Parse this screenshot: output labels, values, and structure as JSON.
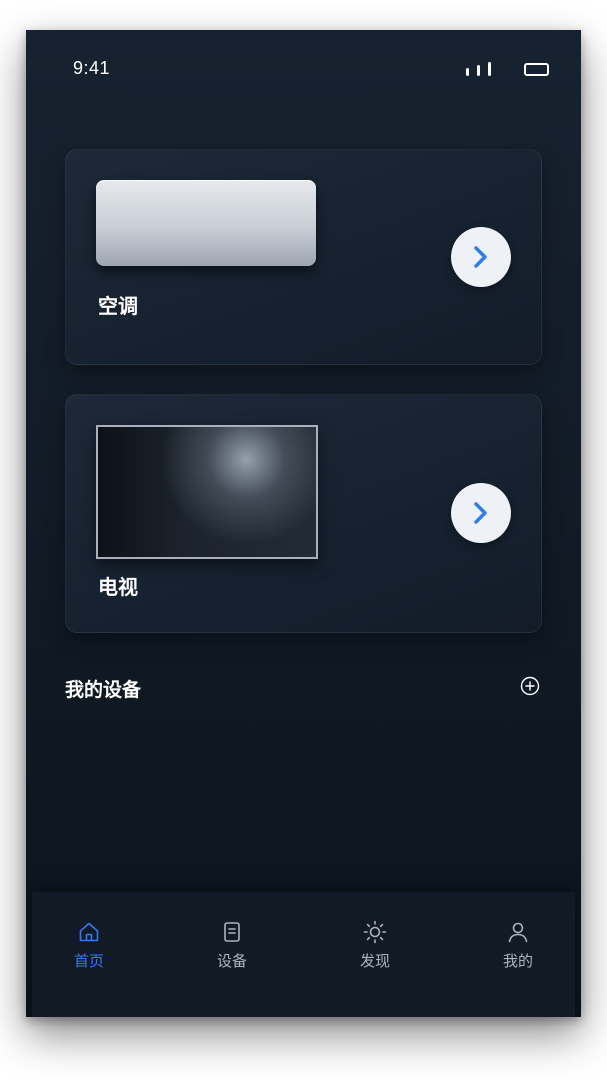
{
  "status_bar": {
    "time": "9:41",
    "signal_icon": "signal-icon",
    "battery_icon": "battery-icon"
  },
  "devices": [
    {
      "label": "空调",
      "image_icon": "air-conditioner-image",
      "action_icon": "chevron-right-icon"
    },
    {
      "label": "电视",
      "image_icon": "television-image",
      "action_icon": "chevron-right-icon"
    }
  ],
  "my_devices": {
    "title": "我的设备",
    "add_icon": "plus-circle-icon"
  },
  "tabbar": {
    "items": [
      {
        "label": "首页",
        "icon": "home-icon",
        "active": true
      },
      {
        "label": "设备",
        "icon": "device-icon",
        "active": false
      },
      {
        "label": "发现",
        "icon": "sun-icon",
        "active": false
      },
      {
        "label": "我的",
        "icon": "user-icon",
        "active": false
      }
    ]
  },
  "colors": {
    "accent": "#2f7bf0",
    "background": "#131c28",
    "inactive_tab": "#aeb4bd"
  }
}
